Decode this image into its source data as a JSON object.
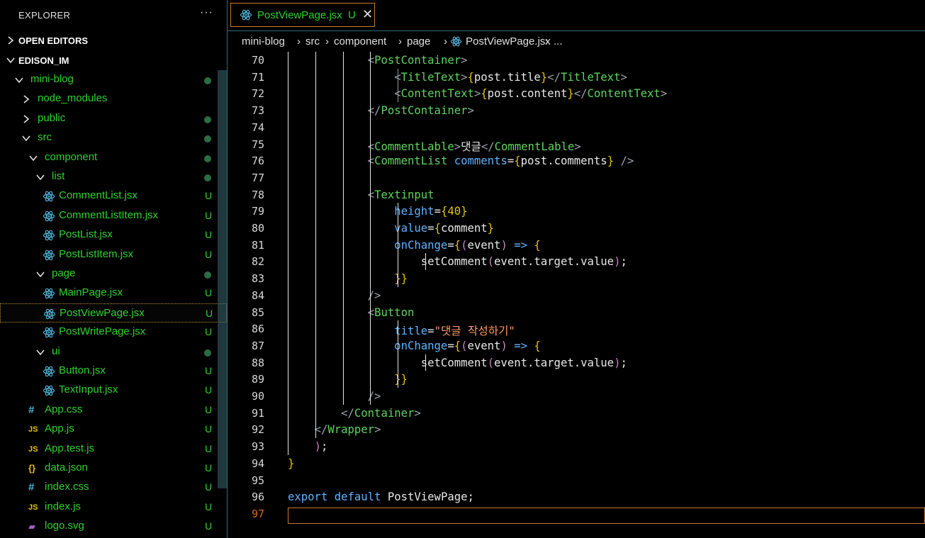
{
  "sidebar": {
    "title": "EXPLORER",
    "more": "···",
    "open_editors": "OPEN EDITORS",
    "workspace": "EDISON_IM",
    "items": [
      {
        "label": "mini-blog",
        "type": "folder",
        "status": "dot"
      },
      {
        "label": "node_modules",
        "type": "folder-collapsed",
        "status": ""
      },
      {
        "label": "public",
        "type": "folder-collapsed",
        "status": "dot"
      },
      {
        "label": "src",
        "type": "folder",
        "status": "dot"
      },
      {
        "label": "component",
        "type": "folder",
        "status": "dot"
      },
      {
        "label": "list",
        "type": "folder",
        "status": "dot"
      },
      {
        "label": "CommentList.jsx",
        "type": "jsx",
        "status": "U"
      },
      {
        "label": "CommentListItem.jsx",
        "type": "jsx",
        "status": "U"
      },
      {
        "label": "PostList.jsx",
        "type": "jsx",
        "status": "U"
      },
      {
        "label": "PostListItem.jsx",
        "type": "jsx",
        "status": "U"
      },
      {
        "label": "page",
        "type": "folder",
        "status": "dot"
      },
      {
        "label": "MainPage.jsx",
        "type": "jsx",
        "status": "U"
      },
      {
        "label": "PostViewPage.jsx",
        "type": "jsx",
        "status": "U",
        "selected": true
      },
      {
        "label": "PostWritePage.jsx",
        "type": "jsx",
        "status": "U"
      },
      {
        "label": "ui",
        "type": "folder",
        "status": "dot"
      },
      {
        "label": "Button.jsx",
        "type": "jsx",
        "status": "U"
      },
      {
        "label": "TextInput.jsx",
        "type": "jsx",
        "status": "U"
      },
      {
        "label": "App.css",
        "type": "css",
        "status": "U"
      },
      {
        "label": "App.js",
        "type": "js",
        "status": "U"
      },
      {
        "label": "App.test.js",
        "type": "js",
        "status": "U"
      },
      {
        "label": "data.json",
        "type": "json",
        "status": "U"
      },
      {
        "label": "index.css",
        "type": "css",
        "status": "U"
      },
      {
        "label": "index.js",
        "type": "js",
        "status": "U"
      },
      {
        "label": "logo.svg",
        "type": "svg",
        "status": "U"
      }
    ]
  },
  "tab": {
    "name": "PostViewPage.jsx",
    "status": "U",
    "close": "✕"
  },
  "breadcrumb": [
    "mini-blog",
    "src",
    "component",
    "page",
    "PostViewPage.jsx",
    "..."
  ],
  "icons": {
    "react": "react-icon",
    "css": "hash-icon",
    "js": "js-icon",
    "json": "braces-icon",
    "svg": "image-icon"
  },
  "colors": {
    "accent_green": "#2fd12f",
    "tab_border": "#c87a2a",
    "panel_border": "#2f6f7a"
  },
  "code": {
    "current_line": 97,
    "lines": [
      {
        "n": 70,
        "t": "            <PostContainer>"
      },
      {
        "n": 71,
        "t": "                <TitleText>{post.title}</TitleText>"
      },
      {
        "n": 72,
        "t": "                <ContentText>{post.content}</ContentText>"
      },
      {
        "n": 73,
        "t": "            </PostContainer>"
      },
      {
        "n": 74,
        "t": ""
      },
      {
        "n": 75,
        "t": "            <CommentLable>댓글</CommentLable>"
      },
      {
        "n": 76,
        "t": "            <CommentList comments={post.comments} />"
      },
      {
        "n": 77,
        "t": ""
      },
      {
        "n": 78,
        "t": "            <Textinput"
      },
      {
        "n": 79,
        "t": "                height={40}"
      },
      {
        "n": 80,
        "t": "                value={comment}"
      },
      {
        "n": 81,
        "t": "                onChange={(event) => {"
      },
      {
        "n": 82,
        "t": "                    setComment(event.target.value);"
      },
      {
        "n": 83,
        "t": "                }}"
      },
      {
        "n": 84,
        "t": "            />"
      },
      {
        "n": 85,
        "t": "            <Button"
      },
      {
        "n": 86,
        "t": "                title=\"댓글 작성하기\""
      },
      {
        "n": 87,
        "t": "                onChange={(event) => {"
      },
      {
        "n": 88,
        "t": "                    setComment(event.target.value);"
      },
      {
        "n": 89,
        "t": "                }}"
      },
      {
        "n": 90,
        "t": "            />"
      },
      {
        "n": 91,
        "t": "        </Container>"
      },
      {
        "n": 92,
        "t": "    </Wrapper>"
      },
      {
        "n": 93,
        "t": "    );"
      },
      {
        "n": 94,
        "t": "}"
      },
      {
        "n": 95,
        "t": ""
      },
      {
        "n": 96,
        "t": "export default PostViewPage;"
      },
      {
        "n": 97,
        "t": ""
      }
    ]
  }
}
